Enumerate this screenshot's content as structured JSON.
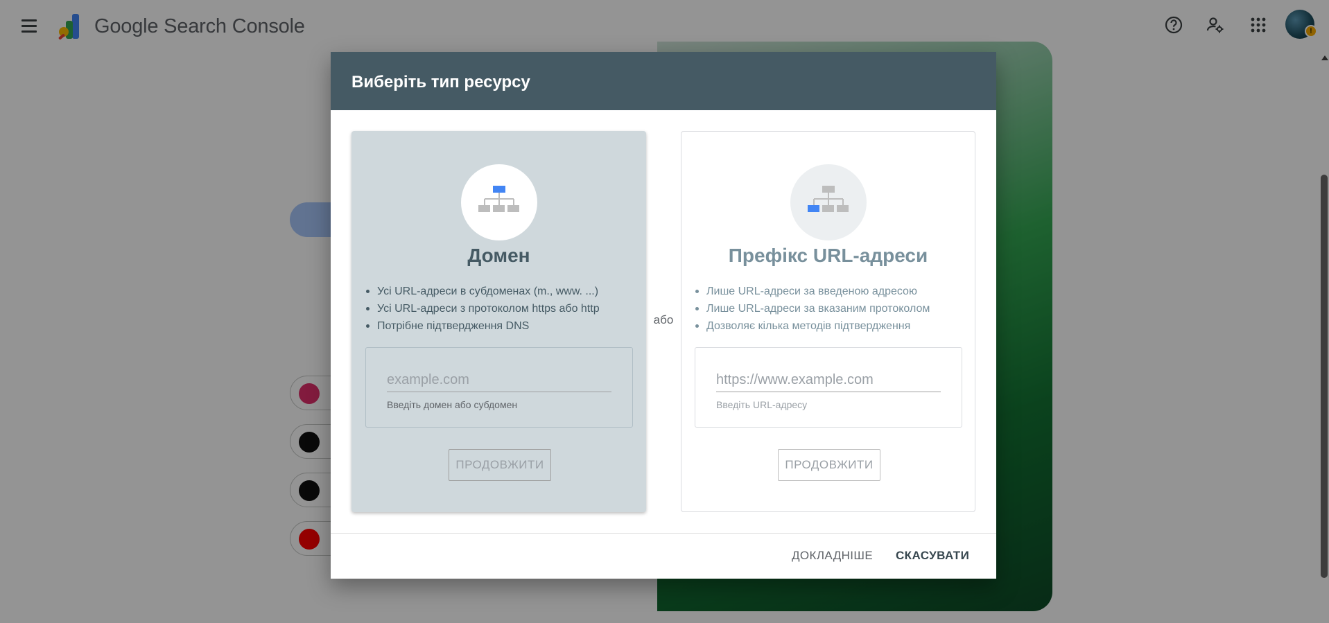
{
  "app": {
    "title": "Google Search Console"
  },
  "topbar_icons": [
    "menu-icon",
    "help-icon",
    "manage-account-icon",
    "apps-grid-icon"
  ],
  "dialog": {
    "title": "Виберіть тип ресурсу",
    "or_label": "або",
    "options": [
      {
        "id": "domain",
        "title": "Домен",
        "icon": "sitemap-top-highlight-icon",
        "selected": true,
        "bullets": [
          "Усі URL-адреси в субдоменах (m., www. ...)",
          "Усі URL-адреси з протоколом https або http",
          "Потрібне підтвердження DNS"
        ],
        "input_placeholder": "example.com",
        "input_value": "",
        "input_hint": "Введіть домен або субдомен",
        "continue_label": "ПРОДОВЖИТИ"
      },
      {
        "id": "url_prefix",
        "title": "Префікс URL-адреси",
        "icon": "sitemap-left-highlight-icon",
        "selected": false,
        "bullets": [
          "Лише URL-адреси за введеною адресою",
          "Лише URL-адреси за вказаним протоколом",
          "Дозволяє кілька методів підтвердження"
        ],
        "input_placeholder": "https://www.example.com",
        "input_value": "",
        "input_hint": "Введіть URL-адресу",
        "continue_label": "ПРОДОВЖИТИ"
      }
    ],
    "footer": {
      "more_label": "ДОКЛАДНІШЕ",
      "cancel_label": "СКАСУВАТИ"
    }
  },
  "colors": {
    "dialog_header": "#455a64",
    "selected_card": "#cfd8dc",
    "highlight_blue": "#4285f4",
    "node_gray": "#bdbdbd",
    "scrim": "rgba(0,0,0,0.42)"
  },
  "background": {
    "social_icons": [
      "instagram-icon",
      "tiktok-icon",
      "x-icon",
      "youtube-icon"
    ]
  }
}
